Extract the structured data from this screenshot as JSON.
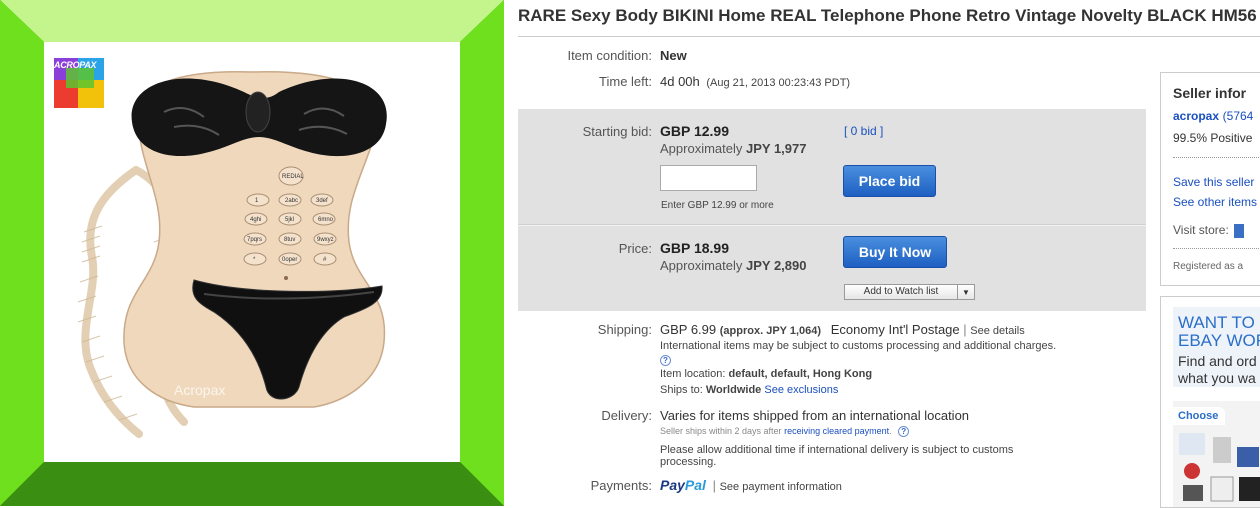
{
  "product": {
    "logo_text": "ACROPAX",
    "watermark": "Acropax"
  },
  "listing": {
    "title": "RARE Sexy Body BIKINI Home REAL Telephone Phone Retro Vintage Novelty BLACK HM56",
    "condition_label": "Item condition:",
    "condition_value": "New",
    "time_left_label": "Time left:",
    "time_left_value": "4d 00h",
    "time_left_end": "(Aug 21, 2013  00:23:43 PDT)"
  },
  "bid": {
    "starting_label": "Starting bid:",
    "starting_price": "GBP 12.99",
    "approx_prefix": "Approximately",
    "approx_value": "JPY 1,977",
    "bids_link": "[ 0 bid ]",
    "input_value": "",
    "enter_hint": "Enter GBP 12.99 or more",
    "place_bid_label": "Place bid"
  },
  "buy": {
    "price_label": "Price:",
    "price": "GBP 18.99",
    "approx_prefix": "Approximately",
    "approx_value": "JPY 2,890",
    "buy_now_label": "Buy It Now",
    "watch_label": "Add to Watch list"
  },
  "shipping": {
    "label": "Shipping:",
    "cost": "GBP 6.99",
    "approx": "(approx. JPY 1,064)",
    "service": "Economy Int'l Postage",
    "separator": "|",
    "details_link": "See details",
    "customs_note": "International items may be subject to customs processing and additional charges.",
    "location_label": "Item location:",
    "location_value": "default, default, Hong Kong",
    "ships_to_label": "Ships to:",
    "ships_to_value": "Worldwide",
    "exclusions_link": "See exclusions"
  },
  "delivery": {
    "label": "Delivery:",
    "value": "Varies for items shipped from an international location",
    "ships_note_prefix": "Seller ships within 2 days after",
    "ships_note_link": "receiving cleared payment",
    "ships_note_suffix": ".",
    "allow_note_1": "Please allow additional time if international delivery is subject to customs",
    "allow_note_2": "processing."
  },
  "payments": {
    "label": "Payments:",
    "paypal_a": "Pay",
    "paypal_b": "Pal",
    "separator": "|",
    "info_link": "See payment information"
  },
  "seller": {
    "heading": "Seller infor",
    "name": "acropax",
    "feedback": "(5764",
    "positive": "99.5% Positive",
    "save_link": "Save this seller",
    "other_link": "See other items",
    "store_label": "Visit store:",
    "registered": "Registered as a"
  },
  "ad": {
    "line1": "WANT TO B",
    "line2": "EBAY WOR",
    "line3": "Find and ord",
    "line4": "what you wa",
    "choose": "Choose"
  },
  "colors": {
    "frame_dark": "#2e8a09",
    "frame_light": "#c3f58c",
    "link": "#1a4fbf",
    "button": "#1e5fc2"
  }
}
